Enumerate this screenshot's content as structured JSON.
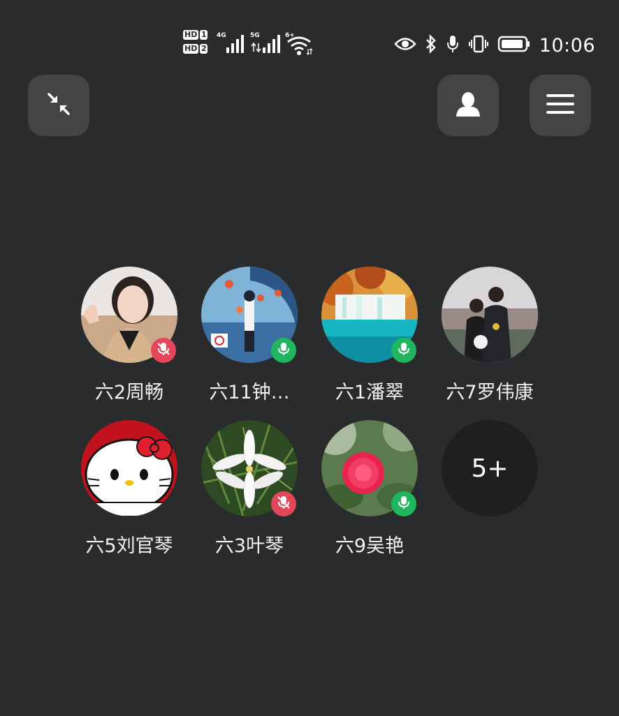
{
  "status_bar": {
    "hd1": "HD",
    "hd1_num": "1",
    "hd2": "HD",
    "hd2_num": "2",
    "net1": "4G",
    "net2": "5G",
    "wifi_label": "6+",
    "time": "10:06",
    "icons": [
      "eye-icon",
      "bluetooth-icon",
      "microphone-icon",
      "vibrate-icon",
      "battery-icon"
    ]
  },
  "toolbar": {
    "minimize_icon": "minimize-arrows-icon",
    "contact_icon": "person-icon",
    "menu_icon": "hamburger-menu-icon"
  },
  "participants": [
    {
      "name": "六2周畅",
      "mic": "muted"
    },
    {
      "name": "六11钟…",
      "mic": "on"
    },
    {
      "name": "六1潘翠",
      "mic": "on"
    },
    {
      "name": "六7罗伟康",
      "mic": "none"
    },
    {
      "name": "六5刘官琴",
      "mic": "none"
    },
    {
      "name": "六3叶琴",
      "mic": "muted"
    },
    {
      "name": "六9吴艳",
      "mic": "on"
    }
  ],
  "more": {
    "label": "5+"
  },
  "colors": {
    "background": "#2a2b2d",
    "button": "#434446",
    "mic_on": "#1fb65f",
    "mic_muted": "#e5475a"
  }
}
